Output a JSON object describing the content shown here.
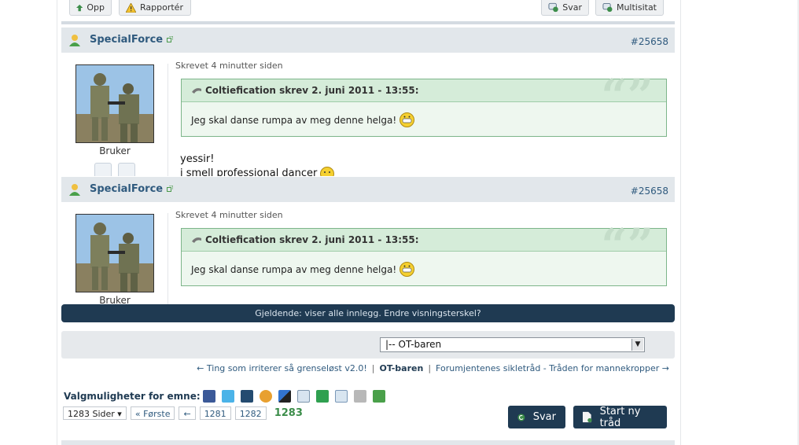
{
  "toolbar": {
    "up_label": "Opp",
    "report_label": "Rapportér",
    "reply_label": "Svar",
    "multiquote_label": "Multisitat"
  },
  "posts": [
    {
      "username": "SpecialForce",
      "post_number": "#25658",
      "timestamp": "Skrevet 4 minutter siden",
      "role": "Bruker",
      "quote_header": "Coltiefication skrev 2. juni 2011 - 13:55:",
      "quote_text": "Jeg skal danse rumpa av meg denne helga!",
      "text_lines": [
        "yessir!",
        "i smell professional dancer"
      ]
    },
    {
      "username": "SpecialForce",
      "post_number": "#25658",
      "timestamp": "Skrevet 4 minutter siden",
      "role": "Bruker",
      "quote_header": "Coltiefication skrev 2. juni 2011 - 13:55:",
      "quote_text": "Jeg skal danse rumpa av meg denne helga!"
    }
  ],
  "filter_bar": {
    "text": "Gjeldende: viser alle innlegg. Endre visningsterskel?"
  },
  "forum_jump": {
    "selected": "|-- OT-baren"
  },
  "thread_nav": {
    "prev": "← Ting som irriterer så grenseløst v2.0!",
    "current": "OT-baren",
    "next": "Forumjentenes sikletråd - Tråden for mannekropper →"
  },
  "topic_options": {
    "label": "Valgmuligheter for emne:",
    "share_icons": [
      "facebook-icon",
      "twitter-icon",
      "digg-icon",
      "google-icon",
      "delicious-icon",
      "reddit-icon",
      "stumbleupon-icon",
      "email-icon",
      "print-icon",
      "download-icon"
    ]
  },
  "pagination": {
    "pages_dropdown": "1283 Sider",
    "first": "« Første",
    "prev": "←",
    "pages": [
      "1281",
      "1282"
    ],
    "current": "1283"
  },
  "actions": {
    "reply": "Svar",
    "new_thread": "Start ny tråd"
  },
  "colors": {
    "dark_navy": "#1f3a52",
    "link_blue": "#2f5a7e",
    "quote_border": "#7db58a",
    "quote_bg": "#eef7ef",
    "current_page_green": "#3c8d4a"
  }
}
